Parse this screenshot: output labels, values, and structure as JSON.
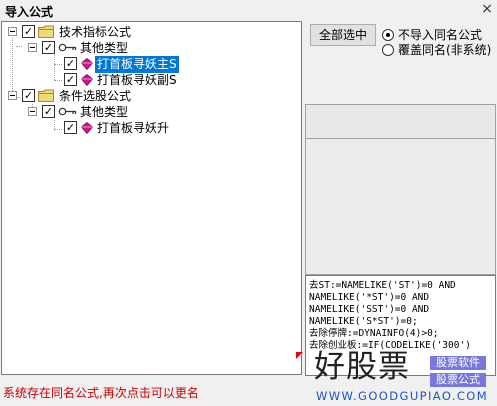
{
  "window": {
    "title": "导入公式",
    "close_label": "×"
  },
  "tree": {
    "nodes": [
      {
        "label": "技术指标公式",
        "checked": true,
        "icon": "folder-icon"
      },
      {
        "label": "其他类型",
        "checked": true,
        "icon": "key-icon"
      },
      {
        "label": "打首板寻妖主S",
        "checked": true,
        "icon": "formula-gem-icon",
        "selected": true
      },
      {
        "label": "打首板寻妖副S",
        "checked": true,
        "icon": "formula-gem-icon"
      },
      {
        "label": "条件选股公式",
        "checked": true,
        "icon": "folder-icon"
      },
      {
        "label": "其他类型",
        "checked": true,
        "icon": "key-icon"
      },
      {
        "label": "打首板寻妖升",
        "checked": true,
        "icon": "formula-gem-icon"
      }
    ]
  },
  "controls": {
    "select_all_label": "全部选中",
    "radio_options": [
      {
        "label": "不导入同名公式",
        "selected": true
      },
      {
        "label": "覆盖同名(非系统)",
        "selected": false
      }
    ]
  },
  "code_lines": [
    "去ST:=NAMELIKE('ST')=0 AND",
    "NAMELIKE('*ST')=0 AND",
    "NAMELIKE('SST')=0 AND",
    "NAMELIKE('S*ST')=0;",
    "去除停牌:=DYNAINFO(4)>0;",
    "去除创业板:=IF(CODELIKE('300')"
  ],
  "status_message": "系统存在同名公式,再次点击可以更名",
  "watermark": {
    "brand": "好股票",
    "tag1": "股票软件",
    "tag2": "股票公式",
    "url": "WWW.GOODGUPIAO.COM"
  },
  "colors": {
    "selection": "#0078d7",
    "status_text": "#cc0000",
    "watermark_url": "#1a55c8",
    "watermark_tag": "#7777dd",
    "folder": "#f5d67a"
  }
}
